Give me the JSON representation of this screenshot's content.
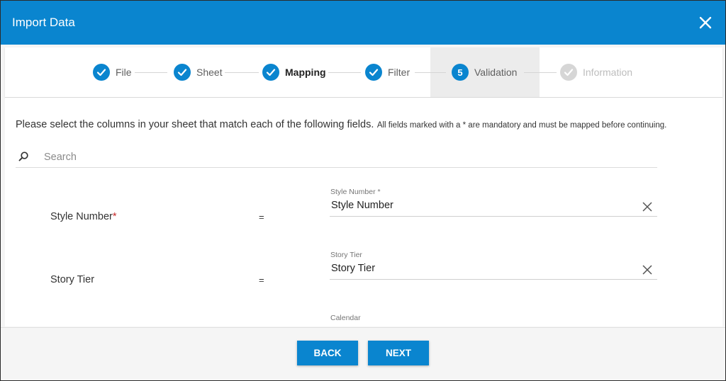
{
  "dialog": {
    "title": "Import Data",
    "close_icon": "close-icon",
    "accent_color": "#0a85cf"
  },
  "steps": [
    {
      "label": "File",
      "state": "complete",
      "icon": "check-icon"
    },
    {
      "label": "Sheet",
      "state": "complete",
      "icon": "check-icon"
    },
    {
      "label": "Mapping",
      "state": "complete-current",
      "icon": "check-icon"
    },
    {
      "label": "Filter",
      "state": "complete",
      "icon": "check-icon"
    },
    {
      "label": "Validation",
      "state": "active",
      "number": "5"
    },
    {
      "label": "Information",
      "state": "disabled",
      "icon": "check-icon"
    }
  ],
  "instructions": {
    "main": "Please select the columns in your sheet that match each of the following fields.",
    "note": "All fields marked with a * are mandatory and must be mapped before continuing."
  },
  "search": {
    "placeholder": "Search",
    "value": "",
    "icon": "search-icon"
  },
  "mappings": [
    {
      "field": "Style Number",
      "required_mark": "*",
      "equals": "=",
      "select_label": "Style Number *",
      "selected": "Style Number"
    },
    {
      "field": "Story Tier",
      "required_mark": "",
      "equals": "=",
      "select_label": "Story Tier",
      "selected": "Story Tier"
    },
    {
      "field": "",
      "required_mark": "",
      "equals": "",
      "select_label": "Calendar",
      "selected": ""
    }
  ],
  "footer": {
    "back_label": "BACK",
    "next_label": "NEXT"
  }
}
